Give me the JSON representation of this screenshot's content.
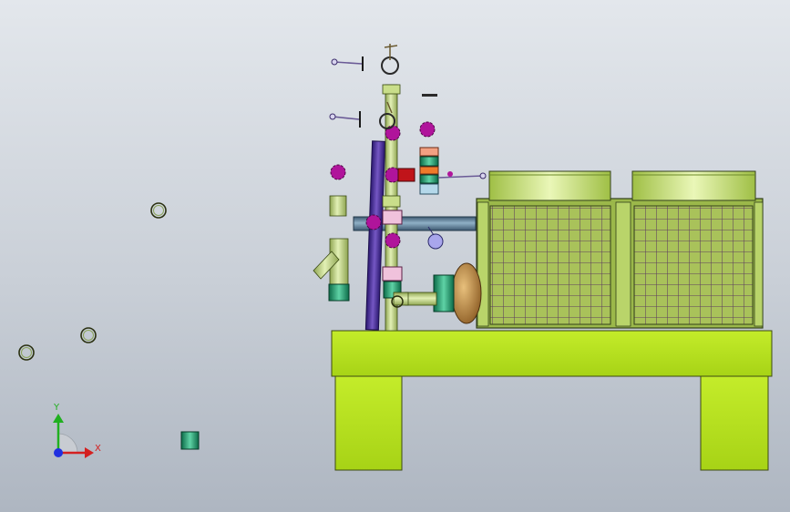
{
  "viewport": {
    "background_top": "#e3e7ec",
    "background_bottom": "#aeb6c1"
  },
  "triad": {
    "x_label": "X",
    "y_label": "Y",
    "x_color": "#d42020",
    "y_color": "#20b020",
    "z_color": "#2030e0"
  },
  "model": {
    "frame_color": "#b7e21e",
    "coil_color": "#9bb84a",
    "fan_hood_color": "#c6e27a",
    "pipe_purple": "#4c2f9a",
    "pipe_green": "#b9d07a",
    "pipe_steel": "#5e7e96",
    "flange_magenta": "#b0149b",
    "valve_teal": "#1f9d6e",
    "pump_bronze": "#b88546"
  }
}
